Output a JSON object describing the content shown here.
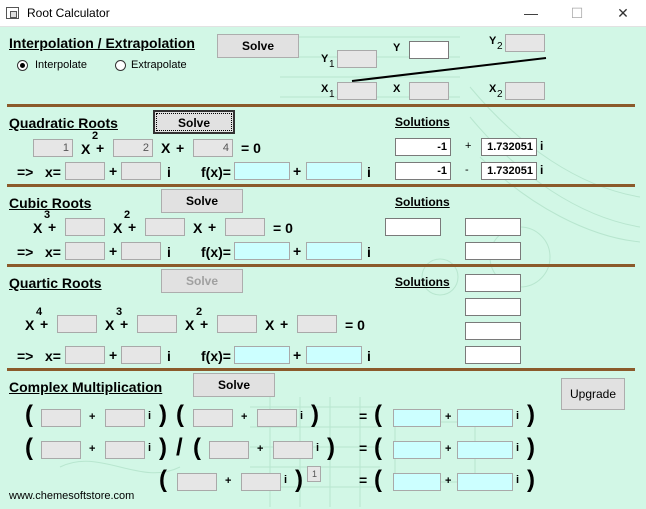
{
  "window": {
    "title": "Root Calculator",
    "minimize": "—",
    "maximize": "☐",
    "close": "✕"
  },
  "interp": {
    "title": "Interpolation / Extrapolation",
    "solve": "Solve",
    "radio1": "Interpolate",
    "radio2": "Extrapolate",
    "selected": "Interpolate",
    "y1": "Y",
    "y1sub": "1",
    "y": "Y",
    "y2": "Y",
    "y2sub": "2",
    "x1": "X",
    "x1sub": "1",
    "x": "X",
    "x2": "X",
    "x2sub": "2"
  },
  "quad": {
    "title": "Quadratic Roots",
    "solve": "Solve",
    "solutions": "Solutions",
    "a": "1",
    "b": "2",
    "c": "4",
    "xsq": "X",
    "exp2": "2",
    "plus1": "+",
    "x": "X",
    "plus2": "+",
    "eq0": "= 0",
    "arrow": "=>",
    "xeq": "x=",
    "plus3": "+",
    "i": "i",
    "fx": "f(x)=",
    "plus4": "+",
    "i2": "i",
    "r1re": "-1",
    "r1sign": "+",
    "r1im": "1.732051",
    "r1i": "i",
    "r2re": "-1",
    "r2sign": "-",
    "r2im": "1.732051",
    "r2i": "i"
  },
  "cubic": {
    "title": "Cubic Roots",
    "solve": "Solve",
    "solutions": "Solutions",
    "x3": "X",
    "exp3": "3",
    "p1": "+",
    "x2": "X",
    "exp2": "2",
    "p2": "+",
    "x": "X",
    "p3": "+",
    "eq0": "= 0",
    "arrow": "=>",
    "xeq": "x=",
    "p4": "+",
    "i": "i",
    "fx": "f(x)=",
    "p5": "+",
    "i2": "i"
  },
  "quartic": {
    "title": "Quartic Roots",
    "solve": "Solve",
    "solutions": "Solutions",
    "x4": "X",
    "exp4": "4",
    "p1": "+",
    "x3": "X",
    "exp3": "3",
    "p2": "+",
    "x2": "X",
    "exp2": "2",
    "p3": "+",
    "x": "X",
    "p4": "+",
    "eq0": "= 0",
    "arrow": "=>",
    "xeq": "x=",
    "p5": "+",
    "i": "i",
    "fx": "f(x)=",
    "p6": "+",
    "i2": "i"
  },
  "complex": {
    "title": "Complex Multiplication",
    "solve": "Solve",
    "upgrade": "Upgrade",
    "open": "(",
    "close": ")",
    "plus": "+",
    "i": "i",
    "div": "/",
    "eq": "=",
    "power": "1",
    "website": "www.chemesoftstore.com"
  },
  "colors": {
    "background": "#d2f7e6",
    "separator": "#8b5a2b",
    "result_box": "#ccffff"
  }
}
